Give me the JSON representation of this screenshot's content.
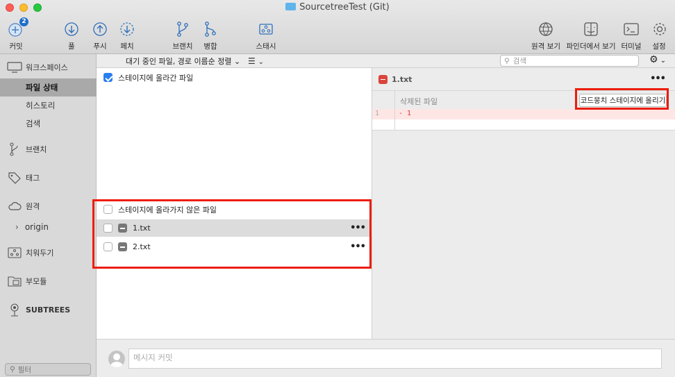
{
  "window": {
    "title": "SourcetreeTest (Git)"
  },
  "toolbar": {
    "commit": {
      "label": "커밋",
      "badge": "2"
    },
    "pull": "풀",
    "push": "푸시",
    "fetch": "페치",
    "branch": "브랜치",
    "merge": "병합",
    "stash": "스태시",
    "remote_view": "원격 보기",
    "show_in_finder": "파인더에서 보기",
    "terminal": "터미널",
    "settings": "설정"
  },
  "sidebar": {
    "workspace": "워크스페이스",
    "file_status": "파일 상태",
    "history": "히스토리",
    "search": "검색",
    "branches": "브랜치",
    "tags": "태그",
    "remotes": "원격",
    "origin": "origin",
    "stashes": "치워두기",
    "submodules": "부모듈",
    "subtrees": "SUBTREES",
    "filter_placeholder": "필터"
  },
  "subbar": {
    "sort": "대기 중인 파일, 경로 이름순 정렬",
    "search_placeholder": "검색"
  },
  "staged": {
    "header": "스테이지에 올라간 파일"
  },
  "unstaged": {
    "header": "스테이지에 올라가지 않은 파일",
    "files": [
      {
        "name": "1.txt"
      },
      {
        "name": "2.txt"
      }
    ]
  },
  "diff": {
    "file": "1.txt",
    "hunk_title": "삭제된 파일",
    "stage_hunk_button": "코드뭉치 스테이지에 올리기",
    "lines": [
      {
        "num": "1",
        "text": "- 1"
      }
    ]
  },
  "commit": {
    "placeholder": "메시지 커밋"
  },
  "colors": {
    "highlight": "#ec1d0b",
    "accent": "#2a7ff0",
    "deleted": "#d9453b"
  }
}
